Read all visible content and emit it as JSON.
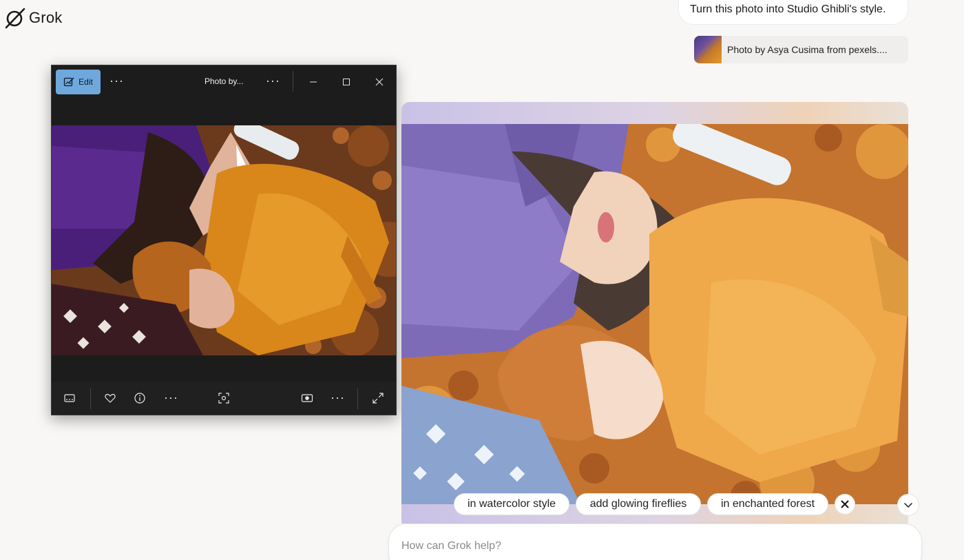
{
  "app": {
    "name": "Grok"
  },
  "conversation": {
    "user_message": "Turn this photo into Studio Ghibli's style.",
    "attachment": {
      "label": "Photo by Asya Cusima from pexels...."
    }
  },
  "photo_viewer": {
    "edit_label": "Edit",
    "title": "Photo by...",
    "more": "···"
  },
  "suggestions": [
    {
      "label": "in watercolor style"
    },
    {
      "label": "add glowing fireflies"
    },
    {
      "label": "in enchanted forest"
    }
  ],
  "prompt": {
    "placeholder": "How can Grok help?"
  },
  "icons": {
    "logo": "grok-logo-icon",
    "edit": "edit-image-icon",
    "minimize": "minimize-icon",
    "maximize": "maximize-icon",
    "close": "close-icon",
    "filmstrip": "filmstrip-icon",
    "favorite": "heart-icon",
    "info": "info-icon",
    "scan": "scan-text-icon",
    "slideshow": "slideshow-icon",
    "fullscreen": "fullscreen-icon",
    "dismiss": "dismiss-icon",
    "scroll": "chevron-down-icon"
  },
  "colors": {
    "accent": "#6fa8dc",
    "background": "#f8f7f5",
    "viewer_bg": "#1c1c1c"
  }
}
